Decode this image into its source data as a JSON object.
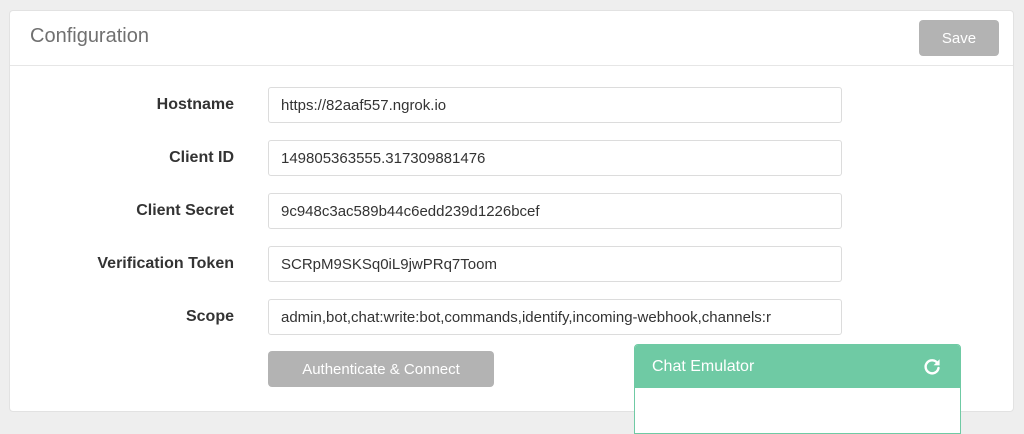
{
  "panel": {
    "title": "Configuration",
    "save_label": "Save"
  },
  "form": {
    "fields": [
      {
        "label": "Hostname",
        "value": "https://82aaf557.ngrok.io"
      },
      {
        "label": "Client ID",
        "value": "149805363555.317309881476"
      },
      {
        "label": "Client Secret",
        "value": "9c948c3ac589b44c6edd239d1226bcef"
      },
      {
        "label": "Verification Token",
        "value": "SCRpM9SKSq0iL9jwPRq7Toom"
      },
      {
        "label": "Scope",
        "value": "admin,bot,chat:write:bot,commands,identify,incoming-webhook,channels:r"
      }
    ],
    "auth_button_label": "Authenticate & Connect"
  },
  "chat_emulator": {
    "title": "Chat Emulator",
    "icon": "refresh-icon"
  },
  "colors": {
    "accent": "#6fcaa4",
    "button_disabled": "#b3b3b3"
  }
}
